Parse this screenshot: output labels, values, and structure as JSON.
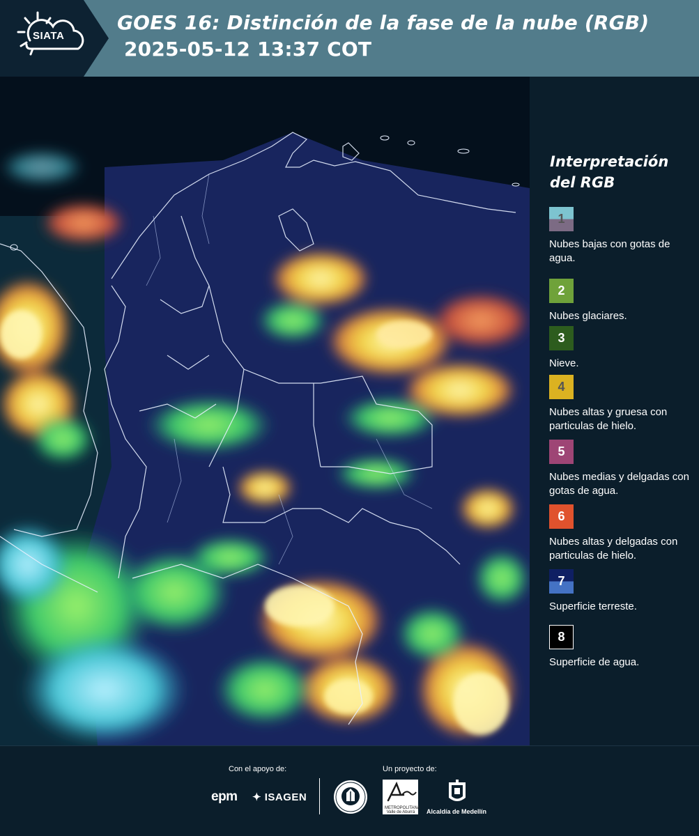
{
  "header": {
    "logo_text": "SIATA",
    "title": "GOES 16: Distinción de la fase de la nube (RGB)",
    "timestamp": "2025-05-12 13:37 COT"
  },
  "legend": {
    "title": "Interpretación del RGB",
    "items": [
      {
        "number": "1",
        "label": "Nubes bajas con gotas de agua.",
        "color_top": "#7dc4d0",
        "color_bottom": "#7c6b84",
        "num_color": "#555555"
      },
      {
        "number": "2",
        "label": "Nubes glaciares.",
        "color_top": "#6fa23a",
        "color_bottom": "#6fa23a",
        "num_color": "#ffffff"
      },
      {
        "number": "3",
        "label": "Nieve.",
        "color_top": "#2d5c1e",
        "color_bottom": "#2d5c1e",
        "num_color": "#ffffff"
      },
      {
        "number": "4",
        "label": "Nubes altas y gruesa con particulas de hielo.",
        "color_top": "#dbb221",
        "color_bottom": "#dbb221",
        "num_color": "#555555"
      },
      {
        "number": "5",
        "label": "Nubes medias y delgadas con gotas de agua.",
        "color_top": "#9e4575",
        "color_bottom": "#9e4575",
        "num_color": "#ffffff"
      },
      {
        "number": "6",
        "label": "Nubes altas y delgadas con particulas de hielo.",
        "color_top": "#e0522d",
        "color_bottom": "#e0522d",
        "num_color": "#ffffff"
      },
      {
        "number": "7",
        "label": "Superficie terreste.",
        "color_top": "#0f1f63",
        "color_bottom": "#4472c4",
        "num_color": "#ffffff"
      },
      {
        "number": "8",
        "label": "Superficie de agua.",
        "color_top": "#000000",
        "color_bottom": "#000000",
        "num_color": "#ffffff"
      }
    ]
  },
  "footer": {
    "support_label": "Con el apoyo de:",
    "project_label": "Un proyecto de:",
    "epm": "epm",
    "isagen": "ISAGEN",
    "area_text": "METROPOLITANA Valle de Aburrá",
    "alcaldia": "Alcaldía de Medellín"
  }
}
